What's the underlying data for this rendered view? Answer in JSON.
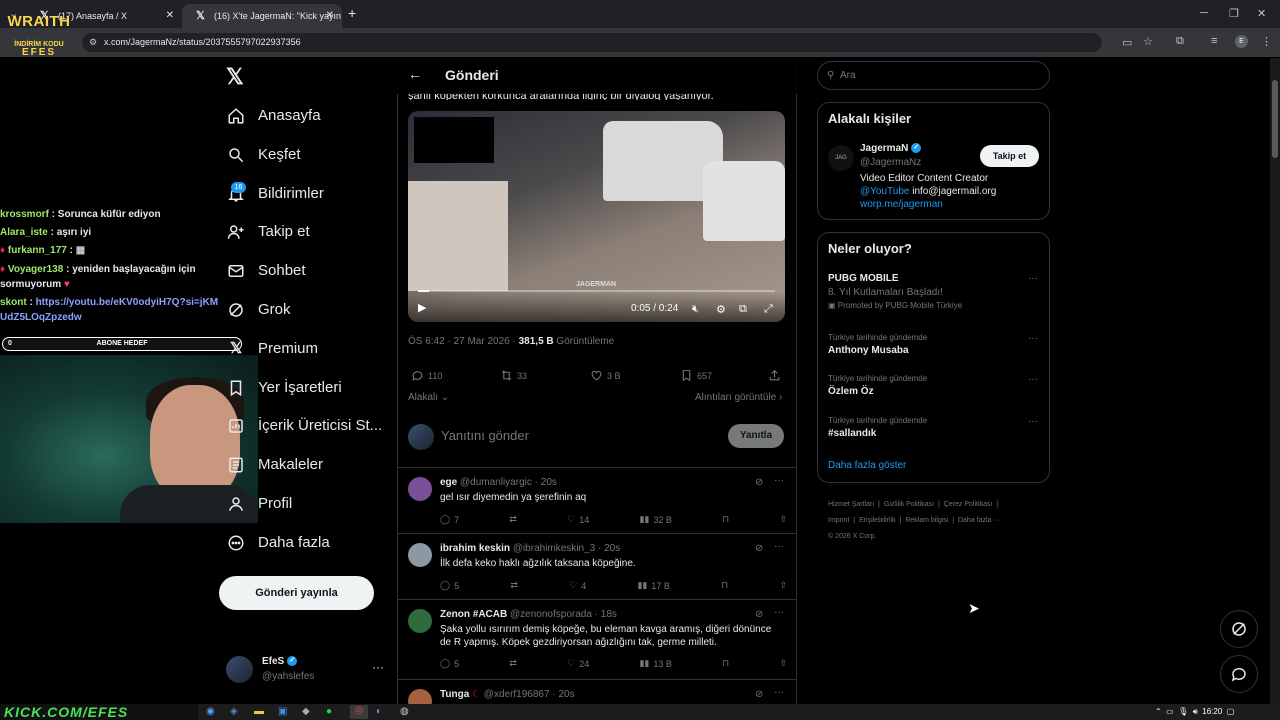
{
  "browser": {
    "tabs": [
      {
        "title": "(17) Anasayfa / X"
      },
      {
        "title": "(16) X'te JagermaN: \"Kick yayın"
      }
    ],
    "url": "x.com/JagermaNz/status/2037555797022937356",
    "new_tab": "+"
  },
  "overlay": {
    "logo": {
      "line1": "WRAITH",
      "line2": "İNDİRİM KODU",
      "line3": "EFES"
    },
    "chat": [
      {
        "user": "krossmorf",
        "msg": "Sorunca küfür ediyon"
      },
      {
        "user": "Alara_iste",
        "msg": "aşırı iyi"
      },
      {
        "user": "furkann_177",
        "msg": ""
      },
      {
        "user": "Voyager138",
        "msg": "yeniden başlayacağın için sormuyorum"
      },
      {
        "user": "skont",
        "msg": "https://youtu.be/eKV0odyiH7Q?si=jKMUdZ5LOqZpzedw"
      }
    ],
    "goal": {
      "value": "0",
      "label": "ABONE HEDEF"
    },
    "kick": "KICK.COM/EFES"
  },
  "sidebar": {
    "items": [
      {
        "label": "Anasayfa",
        "icon": "home-icon"
      },
      {
        "label": "Keşfet",
        "icon": "search-icon"
      },
      {
        "label": "Bildirimler",
        "icon": "bell-icon",
        "badge": "16"
      },
      {
        "label": "Takip et",
        "icon": "follow-icon"
      },
      {
        "label": "Sohbet",
        "icon": "mail-icon"
      },
      {
        "label": "Grok",
        "icon": "grok-icon"
      },
      {
        "label": "Premium",
        "icon": "x-premium-icon"
      },
      {
        "label": "Yer İşaretleri",
        "icon": "bookmark-icon"
      },
      {
        "label": "İçerik Üreticisi St...",
        "icon": "studio-icon"
      },
      {
        "label": "Makaleler",
        "icon": "article-icon"
      },
      {
        "label": "Profil",
        "icon": "profile-icon"
      },
      {
        "label": "Daha fazla",
        "icon": "more-circle-icon"
      }
    ],
    "post_button": "Gönderi yayınla",
    "account": {
      "name": "EfeS",
      "handle": "@yahslefes",
      "more": "···"
    }
  },
  "main": {
    "title": "Gönderi",
    "cut_text": "şanlı köpekten korkunca aralarında ilginç bir diyalog yaşanıyor.",
    "video": {
      "time": "0:05 / 0:24",
      "progress": 0.03,
      "watermark": "JAGERMAN"
    },
    "meta": {
      "time": "ÖS 6:42 · 27 Mar 2026 · ",
      "views": "381,5 B",
      "views_label": " Görüntüleme"
    },
    "actions": {
      "replies": "110",
      "reposts": "33",
      "likes": "3 B",
      "bookmarks": "657"
    },
    "related": "Alakalı",
    "quotes": "Alıntıları görüntüle",
    "reply_placeholder": "Yanıtını gönder",
    "reply_button": "Yanıtla",
    "comments": [
      {
        "name": "ege",
        "handle": "@dumanliyargic",
        "time": "· 20s",
        "text": "gel ısır diyemedin ya şerefinin aq",
        "replies": "7",
        "likes": "14",
        "views": "32 B",
        "avatar_color": "#7a4f9a"
      },
      {
        "name": "ibrahim keskin",
        "handle": "@ibrahimkeskin_3",
        "time": "· 20s",
        "text": "İlk defa keko haklı ağzılık taksana köpeğine.",
        "replies": "5",
        "likes": "4",
        "views": "17 B",
        "avatar_color": "#8b98a5"
      },
      {
        "name": "Zenon #ACAB",
        "handle": "@zenonofsporada",
        "time": "· 18s",
        "text": "Şaka yollu ısırırım demiş köpeğe, bu eleman kavga aramış, diğeri dönünce de R yapmış. Köpek gezdiriyorsan ağızlığını tak, germe milleti.",
        "replies": "5",
        "likes": "24",
        "views": "13 B",
        "avatar_color": "#2f6b3c"
      },
      {
        "name": "Tunga",
        "handle": "@xderf196867",
        "time": "· 20s",
        "text": "",
        "replies": "",
        "likes": "",
        "views": "",
        "avatar_color": "#a5623e"
      }
    ]
  },
  "right": {
    "search_placeholder": "Ara",
    "related_title": "Alakalı kişiler",
    "person": {
      "name": "JagermaN",
      "handle": "@JagermaNz",
      "bio1": "Video Editor Content Creator",
      "bio_link": "@YouTube",
      "bio_email": " info@jagermail.org",
      "bio_site": "worp.me/jagerman",
      "follow": "Takip et"
    },
    "trends_title": "Neler oluyor?",
    "promo": {
      "title": "PUBG MOBILE",
      "sub": "8. Yıl Kutlamaları Başladı!",
      "promoted": "Promoted by PUBG Mobile Türkiye"
    },
    "trends": [
      {
        "context": "Türkiye tarihinde gündemde",
        "topic": "Anthony Musaba"
      },
      {
        "context": "Türkiye tarihinde gündemde",
        "topic": "Özlem Öz"
      },
      {
        "context": "Türkiye tarihinde gündemde",
        "topic": "#sallandık"
      }
    ],
    "show_more": "Daha fazla göster",
    "footer": [
      "Hizmet Şartları",
      "Gizlilik Politikası",
      "Çerez Politikası",
      "Imprint",
      "Erişilebilirlik",
      "Reklam bilgisi",
      "Daha fazla ···",
      "© 2026 X Corp."
    ]
  },
  "taskbar": {
    "clock": "16:20"
  },
  "colors": {
    "accent": "#1d9bf0",
    "bg": "#000000",
    "border": "#2f3336",
    "muted": "#71767b"
  }
}
